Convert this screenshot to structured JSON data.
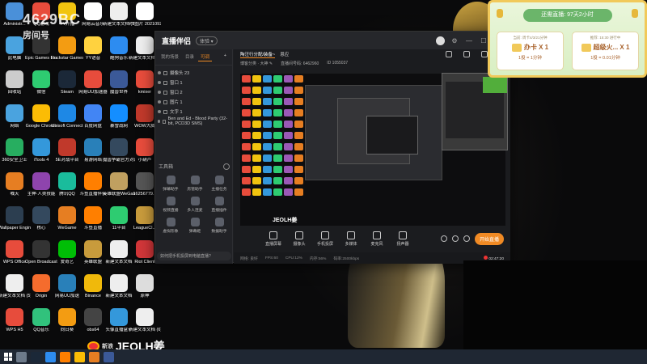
{
  "desktop": {
    "watermark": {
      "line1": "房间号",
      "line2": "4629BC",
      "line3": "Adm"
    },
    "icons": [
      {
        "label": "Administr...",
        "color": "#4a90d9"
      },
      {
        "label": "QQ游戏",
        "color": "#e74c3c"
      },
      {
        "label": "YY开播",
        "color": "#f1c40f"
      },
      {
        "label": "网易云音乐",
        "color": "#fff"
      },
      {
        "label": "新建文本文档 (3)",
        "color": "#eee"
      },
      {
        "label": "YY图片 20210921...",
        "color": "#fff"
      },
      {
        "label": "此电脑",
        "color": "#4aa3df"
      },
      {
        "label": "Epic Games Launcher",
        "color": "#333"
      },
      {
        "label": "Rockstar Games...",
        "color": "#f39c12"
      },
      {
        "label": "YY语音",
        "color": "#ffd23f"
      },
      {
        "label": "酷狗音乐",
        "color": "#2d8cf0"
      },
      {
        "label": "新建文本文档 (2)",
        "color": "#eee"
      },
      {
        "label": "回收站",
        "color": "#ccc"
      },
      {
        "label": "微信",
        "color": "#2ecc71"
      },
      {
        "label": "Steam",
        "color": "#1b2838"
      },
      {
        "label": "网易UU加速器",
        "color": "#e74c3c"
      },
      {
        "label": "魔兽世界",
        "color": "#3b5998"
      },
      {
        "label": "kmixer",
        "color": "#e74c3c"
      },
      {
        "label": "网络",
        "color": "#4aa3df"
      },
      {
        "label": "Google Chrome",
        "color": "#fbbc05"
      },
      {
        "label": "Ubisoft Connect",
        "color": "#1e88e5"
      },
      {
        "label": "百度网盘",
        "color": "#4285f4"
      },
      {
        "label": "暴雪战网",
        "color": "#148eff"
      },
      {
        "label": "WOW大脚",
        "color": "#c0392b"
      },
      {
        "label": "360安全卫士",
        "color": "#27ae60"
      },
      {
        "label": "iTools 4",
        "color": "#3498db"
      },
      {
        "label": "5E对战平台",
        "color": "#c0392b"
      },
      {
        "label": "易游网络",
        "color": "#2980b9"
      },
      {
        "label": "魔兽争霸官方对战平台",
        "color": "#34495e"
      },
      {
        "label": "小葫芦",
        "color": "#e74c3c"
      },
      {
        "label": "喊天",
        "color": "#e67e22"
      },
      {
        "label": "主神·人类技能",
        "color": "#8e44ad"
      },
      {
        "label": "腾讯QQ",
        "color": "#1abc9c"
      },
      {
        "label": "斗鱼直播伴侣",
        "color": "#ff7f00"
      },
      {
        "label": "英雄联盟WeGame版",
        "color": "#c0a060"
      },
      {
        "label": "16256779...",
        "color": "#555"
      },
      {
        "label": "Wallpaper Engine",
        "color": "#2c3e50"
      },
      {
        "label": "核心",
        "color": "#34495e"
      },
      {
        "label": "WeGame",
        "color": "#e67e22"
      },
      {
        "label": "斗鱼直播",
        "color": "#ff7f00"
      },
      {
        "label": "11平台",
        "color": "#2ecc71"
      },
      {
        "label": "LeagueCl...",
        "color": "#c89b3c"
      },
      {
        "label": "WPS Office",
        "color": "#e74c3c"
      },
      {
        "label": "Open Broadcast...",
        "color": "#333"
      },
      {
        "label": "爱奇艺",
        "color": "#00be06"
      },
      {
        "label": "英雄联盟",
        "color": "#c89b3c"
      },
      {
        "label": "新建文本文档",
        "color": "#eee"
      },
      {
        "label": "Riot Client",
        "color": "#d13639"
      },
      {
        "label": "新建文本文档 (5)",
        "color": "#eee"
      },
      {
        "label": "Origin",
        "color": "#f56c2d"
      },
      {
        "label": "网易UU加速",
        "color": "#2980b9"
      },
      {
        "label": "Binance",
        "color": "#f0b90b"
      },
      {
        "label": "新建文本文档",
        "color": "#eee"
      },
      {
        "label": "原神",
        "color": "#ddd"
      },
      {
        "label": "WPS H5",
        "color": "#e74c3c"
      },
      {
        "label": "QQ音乐",
        "color": "#31c27c"
      },
      {
        "label": "向日葵",
        "color": "#f39c12"
      },
      {
        "label": "obs64",
        "color": "#444"
      },
      {
        "label": "头像直播盒子",
        "color": "#3498db"
      },
      {
        "label": "新建文本文档 (6)",
        "color": "#eee"
      }
    ]
  },
  "app": {
    "logo": "直播伴侣",
    "version": "体验 ▾",
    "left_tabs": [
      "我的场景",
      "目录",
      "可调",
      "+"
    ],
    "scenes": [
      {
        "label": "摄像头 23"
      },
      {
        "label": "窗口 1"
      },
      {
        "label": "窗口 2"
      },
      {
        "label": "图片 1"
      },
      {
        "label": "文字 1"
      },
      {
        "label": "Ben and Ed - Blood Party (32-bit, PCD3D SMS)"
      }
    ],
    "tools_title": "工具箱",
    "tools": [
      {
        "label": "弹幕助手"
      },
      {
        "label": "房管助手"
      },
      {
        "label": "主播任务"
      },
      {
        "label": "视频直播"
      },
      {
        "label": "多人连麦"
      },
      {
        "label": "直播插件"
      },
      {
        "label": "虚拟形象"
      },
      {
        "label": "弹幕姬"
      },
      {
        "label": "数据助手"
      }
    ],
    "left_footer": "如何把手机投屏到电脑直播?",
    "main_tabs": [
      {
        "label": "陶汪行分配/装备~",
        "active": true
      },
      {
        "label": "恩应",
        "active": false
      }
    ],
    "info": [
      "博客分类 · 大神 ✎",
      "直播间号码: 6462960",
      "ID 1055037"
    ],
    "preview_watermark": "JEOLH姜",
    "controls": [
      {
        "label": "直播屏幕"
      },
      {
        "label": "摄像头"
      },
      {
        "label": "手机投屏"
      },
      {
        "label": "多媒体"
      },
      {
        "label": "麦克风"
      },
      {
        "label": "扬声器"
      }
    ],
    "start_label": "开始直播",
    "status": [
      "网络: 良好",
      "FPS:60",
      "CPU:12%",
      "内存:56%",
      "码率:2500kbps"
    ],
    "time": "02:47:20"
  },
  "banner": {
    "title": "还需直播: 97天2小时",
    "cards": [
      {
        "top": "当前: 周卡4/3/21分钟",
        "name": "办卡 X 1",
        "price": "1投 = 1分钟"
      },
      {
        "top": "推荐: 15:30 进行中",
        "name": "超级火... X 1",
        "price": "1投 = 0.01分钟"
      }
    ]
  },
  "weibo": {
    "prefix": "新浪",
    "name": "JEOLH姜"
  }
}
